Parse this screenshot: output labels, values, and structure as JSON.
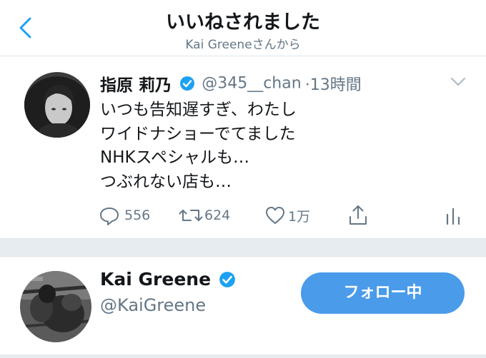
{
  "header": {
    "title": "いいねされました",
    "subtitle": "Kai Greeneさんから",
    "back_icon": "chevron-left-icon"
  },
  "tweet": {
    "author_name": "指原 莉乃",
    "verified_icon": "verified-badge-icon",
    "handle": "@345__chan",
    "time": "·13時間",
    "lines": [
      "いつも告知遅すぎ、わたし",
      "ワイドナショーでてました",
      "NHKスペシャルも…",
      "つぶれない店も…"
    ],
    "actions": {
      "reply_count": "556",
      "retweet_count": "624",
      "like_count": "1万"
    }
  },
  "user": {
    "name": "Kai Greene",
    "handle": "@KaiGreene",
    "follow_label": "フォロー中"
  },
  "colors": {
    "accent": "#4a9bea",
    "secondary_text": "#657786",
    "separator": "#e6ecf0"
  }
}
